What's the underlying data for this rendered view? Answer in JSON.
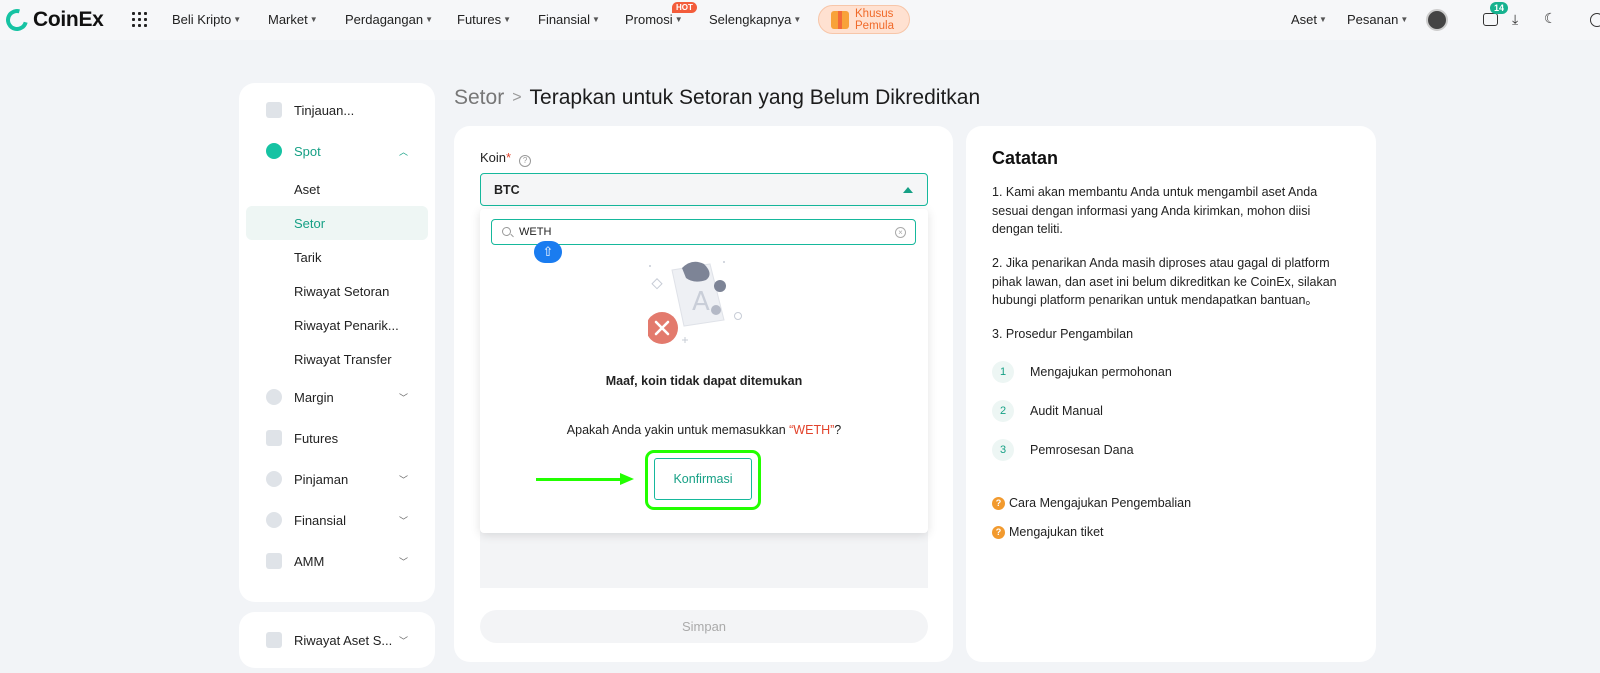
{
  "topnav": {
    "logo": "CoinEx",
    "items": [
      "Beli Kripto",
      "Market",
      "Perdagangan",
      "Futures",
      "Finansial",
      "Promosi",
      "Selengkapnya"
    ],
    "hot_badge": "HOT",
    "promo_line1": "Khusus",
    "promo_line2": "Pemula",
    "right_items": [
      "Aset",
      "Pesanan"
    ],
    "message_count": "14"
  },
  "sidebar": {
    "items": [
      {
        "label": "Tinjauan..."
      },
      {
        "label": "Spot"
      },
      {
        "label": "Aset"
      },
      {
        "label": "Setor"
      },
      {
        "label": "Tarik"
      },
      {
        "label": "Riwayat Setoran"
      },
      {
        "label": "Riwayat Penarik..."
      },
      {
        "label": "Riwayat Transfer"
      },
      {
        "label": "Margin"
      },
      {
        "label": "Futures"
      },
      {
        "label": "Pinjaman"
      },
      {
        "label": "Finansial"
      },
      {
        "label": "AMM"
      }
    ],
    "bottom_item": "Riwayat Aset S..."
  },
  "breadcrumb": {
    "parent": "Setor",
    "current": "Terapkan untuk Setoran yang Belum Dikreditkan"
  },
  "form": {
    "coin_label": "Koin",
    "required_mark": "*",
    "selected_coin": "BTC",
    "search_value": "WETH",
    "empty_message": "Maaf, koin tidak dapat ditemukan",
    "confirm_prefix": "Apakah Anda yakin untuk memasukkan ",
    "confirm_value": "“WETH”",
    "confirm_suffix": "?",
    "confirm_button": "Konfirmasi",
    "save_button": "Simpan"
  },
  "notes": {
    "title": "Catatan",
    "p1": "1. Kami akan membantu Anda untuk mengambil aset Anda sesuai dengan informasi yang Anda kirimkan, mohon diisi dengan teliti.",
    "p2": "2. Jika penarikan Anda masih diproses atau gagal di platform pihak lawan, dan aset ini belum dikreditkan ke CoinEx, silakan hubungi platform penarikan untuk mendapatkan bantuan。",
    "p3": "3. Prosedur Pengambilan",
    "steps": [
      {
        "num": "1",
        "label": "Mengajukan permohonan"
      },
      {
        "num": "2",
        "label": "Audit Manual"
      },
      {
        "num": "3",
        "label": "Pemrosesan Dana"
      }
    ],
    "faq1": "Cara Mengajukan Pengembalian",
    "faq2": "Mengajukan tiket"
  },
  "colors": {
    "accent": "#16a085",
    "highlight_frame": "#22ff00",
    "error": "#e2432c"
  }
}
